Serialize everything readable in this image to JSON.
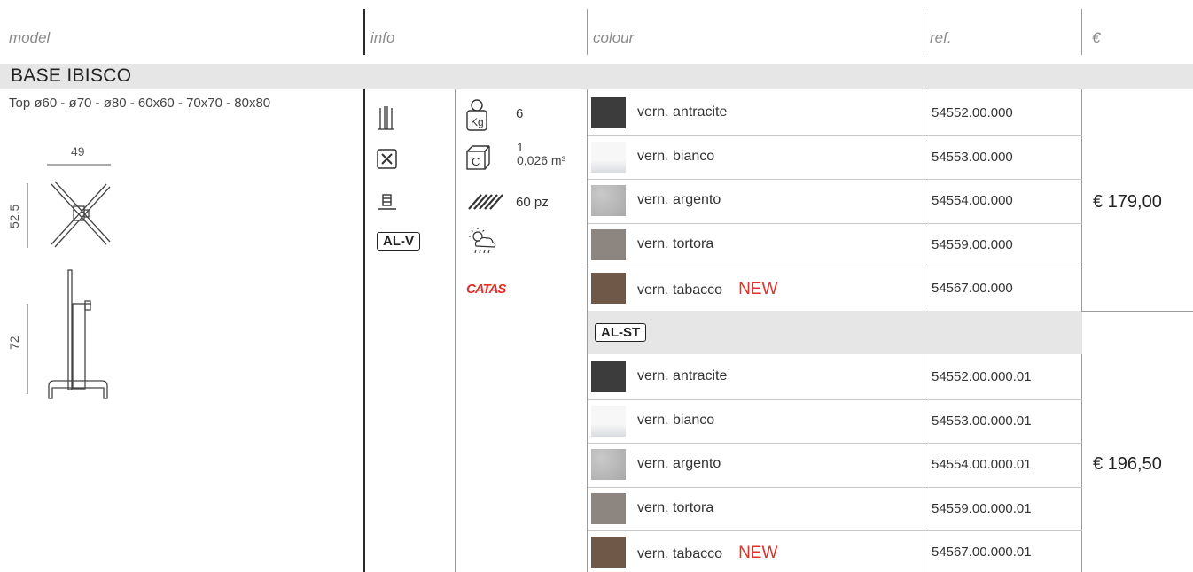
{
  "headers": {
    "model": "model",
    "info": "info",
    "colour": "colour",
    "ref": "ref.",
    "price": "€"
  },
  "section_title": "BASE IBISCO",
  "model_desc": "Top  ø60 - ø70 - ø80 - 60x60 - 70x70 - 80x80",
  "dims": {
    "width": "49",
    "depth": "52,5",
    "height": "72"
  },
  "tags": {
    "alv": "AL-V",
    "alst": "AL-ST"
  },
  "info": {
    "weight": "6",
    "carton_qty": "1",
    "carton_vol": "0,026 m³",
    "pallet": "60 pz",
    "catas_logo": "CATAS",
    "icons": [
      "stacking-icon",
      "assembly-tools-icon",
      "base-weight-icon",
      "weight-kg-icon",
      "carton-icon",
      "pallet-icon",
      "outdoor-weather-icon"
    ]
  },
  "new_label": "NEW",
  "groups": [
    {
      "price": "€ 179,00",
      "rows": [
        {
          "name": "vern. antracite",
          "ref": "54552.00.000",
          "color": "#3c3c3c",
          "new": false
        },
        {
          "name": "vern. bianco",
          "ref": "54553.00.000",
          "color": "#f2f2f2",
          "new": false
        },
        {
          "name": "vern. argento",
          "ref": "54554.00.000",
          "color": "#b9b9b9",
          "new": false
        },
        {
          "name": "vern. tortora",
          "ref": "54559.00.000",
          "color": "#8c8580",
          "new": false
        },
        {
          "name": "vern. tabacco",
          "ref": "54567.00.000",
          "color": "#6f5847",
          "new": true
        }
      ]
    },
    {
      "price": "€ 196,50",
      "rows": [
        {
          "name": "vern. antracite",
          "ref": "54552.00.000.01",
          "color": "#3c3c3c",
          "new": false
        },
        {
          "name": "vern. bianco",
          "ref": "54553.00.000.01",
          "color": "#f2f2f2",
          "new": false
        },
        {
          "name": "vern. argento",
          "ref": "54554.00.000.01",
          "color": "#b9b9b9",
          "new": false
        },
        {
          "name": "vern. tortora",
          "ref": "54559.00.000.01",
          "color": "#8c8580",
          "new": false
        },
        {
          "name": "vern. tabacco",
          "ref": "54567.00.000.01",
          "color": "#6f5847",
          "new": true
        }
      ]
    }
  ]
}
